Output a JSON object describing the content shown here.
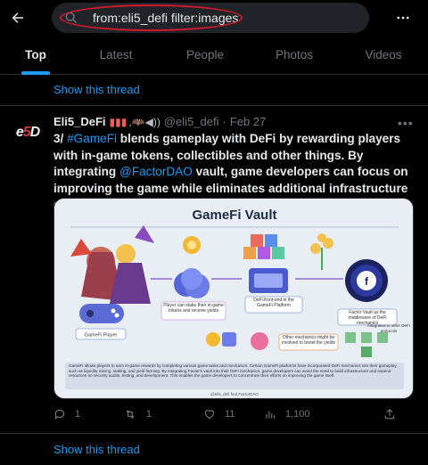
{
  "search": {
    "query": "from:eli5_defi filter:images"
  },
  "tabs": [
    {
      "label": "Top",
      "active": true
    },
    {
      "label": "Latest"
    },
    {
      "label": "People"
    },
    {
      "label": "Photos"
    },
    {
      "label": "Videos"
    }
  ],
  "show_thread_top": "Show this thread",
  "tweet": {
    "avatar_text": "e5D",
    "name": "Eli5_DeFi",
    "handle": "@eli5_defi",
    "dot": "·",
    "date": "Feb 27",
    "text_prefix": "3/ ",
    "hashtag": "#GameFi",
    "text_1": " blends gameplay with DeFi by rewarding players with in-game tokens, collectibles and other things. By integrating ",
    "mention": "@FactorDAO",
    "text_2": " vault, game developers can focus on improving the game while eliminates additional infrastructure development, security and integrations.",
    "image": {
      "title": "GameFi Vault",
      "labels": {
        "player_stake": "Player can stake their in-game tokens and receive yields",
        "defi_frontend": "DeFi front-end in the GameFi Platform",
        "factor_vault": "Factor Vault as the middleware of DeFi mechanics",
        "gamefi_player": "GameFi Player",
        "other_mechanics": "Other mechanics might be involved to boost the yields",
        "integrated": "Integrated to other DeFi protocols"
      },
      "caption": "GameFi allows players to earn in-game rewards by completing various game tasks and mechanics. Certain GameFi platforms have incorporated DeFi mechanics into their gameplay, such as liquidity mining, staking, and yield farming. By integrating Factor's vault into their DeFi mechanics, game developers can avoid the need to build infrastructure and expend resources on security audits, testing, and development. This enables the game developers to concentrate their efforts on improving the game itself.",
      "credit": "@eli5_defi feat.FactorDAO"
    },
    "actions": {
      "replies": "1",
      "retweets": "1",
      "likes": "11",
      "views": "1,100"
    }
  },
  "show_thread_bottom": "Show this thread",
  "colors": {
    "accent": "#1d9bf0",
    "highlight": "#d11a2a",
    "background": "#000000"
  }
}
